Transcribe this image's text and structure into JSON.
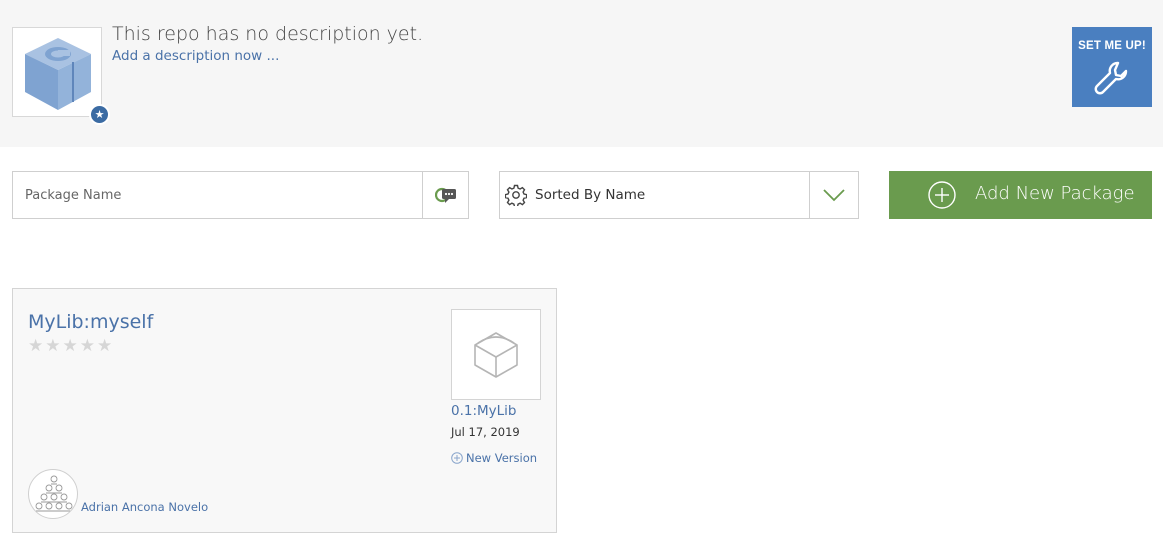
{
  "repo": {
    "no_description": "This repo has no description yet.",
    "add_description": "Add a description now ...",
    "logo_icon": "conan-cube-icon",
    "starred_icon": "star-icon"
  },
  "setup": {
    "label": "SET ME UP!",
    "icon": "wrench-icon",
    "color": "#4a7fc0"
  },
  "search": {
    "placeholder": "Package Name",
    "value": "",
    "button_icon": "filter-chat-icon"
  },
  "sort": {
    "label": "Sorted By Name",
    "icon": "gear-icon",
    "dropdown_icon": "chevron-down-icon"
  },
  "add_package": {
    "label": "Add New Package",
    "icon": "plus-circle-icon",
    "color": "#6a9b4e"
  },
  "packages": [
    {
      "name": "MyLib:myself",
      "rating": 0,
      "max_rating": 5,
      "latest_version": "0.1:MyLib",
      "date": "Jul 17, 2019",
      "new_version_label": "New Version",
      "owner": "Adrian Ancona Novelo",
      "thumbnail_icon": "package-box-icon",
      "avatar_icon": "identicon-avatar"
    }
  ],
  "colors": {
    "link": "#4a72a8",
    "header_bg": "#f6f6f6",
    "card_bg": "#f8f8f8"
  }
}
